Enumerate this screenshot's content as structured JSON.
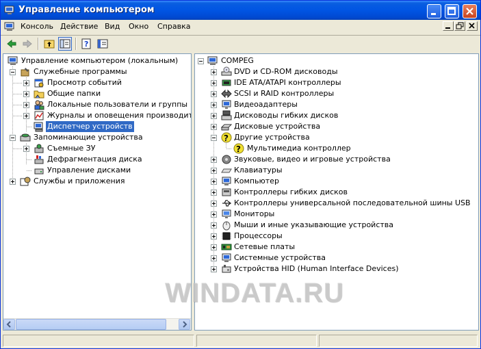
{
  "window": {
    "title": "Управление компьютером"
  },
  "menu": {
    "items": [
      "Консоль",
      "Действие",
      "Вид",
      "Окно",
      "Справка"
    ]
  },
  "left_tree": {
    "root": "Управление компьютером (локальным)",
    "items": [
      "Служебные программы",
      "Просмотр событий",
      "Общие папки",
      "Локальные пользователи и группы",
      "Журналы и оповещения производительн",
      "Диспетчер устройств",
      "Запоминающие устройства",
      "Съемные ЗУ",
      "Дефрагментация диска",
      "Управление дисками",
      "Службы и приложения"
    ]
  },
  "right_tree": {
    "root": "COMPEG",
    "items": [
      "DVD и CD-ROM дисководы",
      "IDE ATA/ATAPI контроллеры",
      "SCSI и RAID контроллеры",
      "Видеоадаптеры",
      "Дисководы гибких дисков",
      "Дисковые устройства",
      "Другие устройства",
      "Мультимедиа контроллер",
      "Звуковые, видео и игровые устройства",
      "Клавиатуры",
      "Компьютер",
      "Контроллеры гибких дисков",
      "Контроллеры универсальной последовательной шины USB",
      "Мониторы",
      "Мыши и иные указывающие устройства",
      "Процессоры",
      "Сетевые платы",
      "Системные устройства",
      "Устройства HID (Human Interface Devices)"
    ]
  },
  "watermark": "WINDATA.RU"
}
